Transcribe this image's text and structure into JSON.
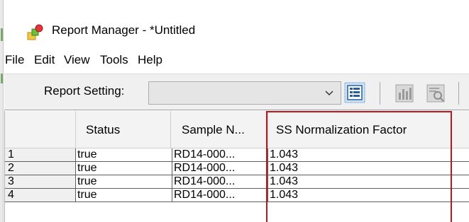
{
  "window": {
    "title": "Report Manager - *Untitled",
    "icon": "report-manager-app-icon"
  },
  "menu": {
    "items": [
      "File",
      "Edit",
      "View",
      "Tools",
      "Help"
    ]
  },
  "toolbar": {
    "report_setting_label": "Report Setting:",
    "report_setting_value": "",
    "icons": [
      "report-list-icon",
      "chart-icon",
      "preview-icon"
    ]
  },
  "table": {
    "columns": [
      "",
      "Status",
      "Sample N...",
      "SS Normalization Factor"
    ],
    "rows": [
      {
        "index": "1",
        "status": "true",
        "sample": "RD14-000...",
        "ss_factor": "1.043"
      },
      {
        "index": "2",
        "status": "true",
        "sample": "RD14-000...",
        "ss_factor": "1.043"
      },
      {
        "index": "3",
        "status": "true",
        "sample": "RD14-000...",
        "ss_factor": "1.043"
      },
      {
        "index": "4",
        "status": "true",
        "sample": "RD14-000...",
        "ss_factor": "1.043"
      }
    ]
  },
  "colors": {
    "highlight": "#c0151b",
    "toolbar_bg": "#f0f0f0",
    "grid_line": "#5e5e5e"
  }
}
